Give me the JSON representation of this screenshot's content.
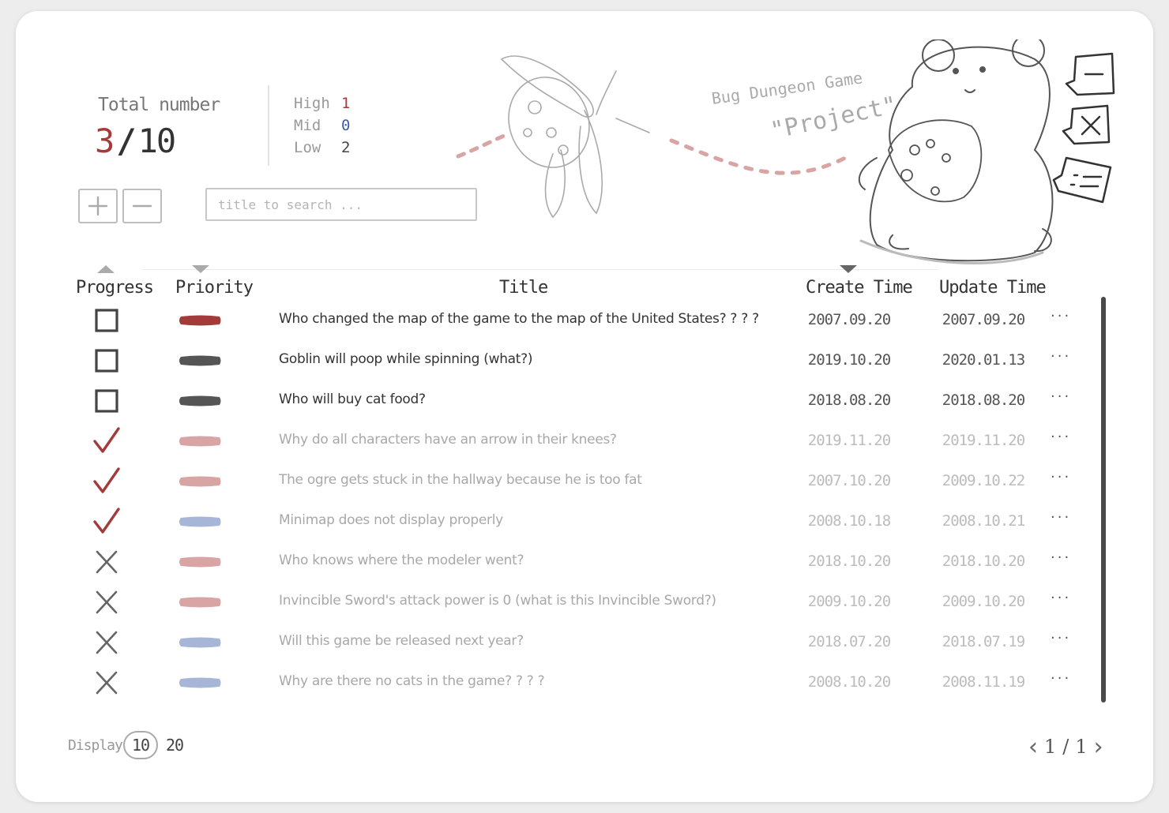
{
  "stats": {
    "total_label": "Total number",
    "done": "3",
    "separator": "/",
    "total": "10",
    "priorities": [
      {
        "label": "High",
        "value": "1",
        "level": "high"
      },
      {
        "label": "Mid",
        "value": "0",
        "level": "mid"
      },
      {
        "label": "Low",
        "value": "2",
        "level": "low"
      }
    ]
  },
  "toolbar": {
    "add_icon": "plus-icon",
    "remove_icon": "minus-icon",
    "search_placeholder": "title to search ..."
  },
  "illustration": {
    "project_line1": "Bug Dungeon Game",
    "project_line2": "\"Project\""
  },
  "table": {
    "columns": {
      "progress": "Progress",
      "priority": "Priority",
      "title": "Title",
      "create_time": "Create Time",
      "update_time": "Update Time"
    },
    "more_label": "···",
    "rows": [
      {
        "status": "open",
        "priority": "high",
        "title": "Who changed the map of the game to the map of the United States? ? ? ?",
        "create": "2007.09.20",
        "update": "2007.09.20"
      },
      {
        "status": "open",
        "priority": "low",
        "title": "Goblin will poop while spinning (what?)",
        "create": "2019.10.20",
        "update": "2020.01.13"
      },
      {
        "status": "open",
        "priority": "low",
        "title": "Who will buy cat food?",
        "create": "2018.08.20",
        "update": "2018.08.20"
      },
      {
        "status": "done",
        "priority": "high",
        "title": "Why do all characters have an arrow in their knees?",
        "create": "2019.11.20",
        "update": "2019.11.20"
      },
      {
        "status": "done",
        "priority": "high",
        "title": "The ogre gets stuck in the hallway because he is too fat",
        "create": "2007.10.20",
        "update": "2009.10.22"
      },
      {
        "status": "done",
        "priority": "mid",
        "title": "Minimap does not display properly",
        "create": "2008.10.18",
        "update": "2008.10.21"
      },
      {
        "status": "rejected",
        "priority": "high",
        "title": "Who knows where the modeler went?",
        "create": "2018.10.20",
        "update": "2018.10.20"
      },
      {
        "status": "rejected",
        "priority": "high",
        "title": "Invincible Sword's attack power is 0 (what is this Invincible Sword?)",
        "create": "2009.10.20",
        "update": "2009.10.20"
      },
      {
        "status": "rejected",
        "priority": "mid",
        "title": "Will this game be released next year?",
        "create": "2018.07.20",
        "update": "2018.07.19"
      },
      {
        "status": "rejected",
        "priority": "mid",
        "title": "Why are there no cats in the game? ? ? ?",
        "create": "2008.10.20",
        "update": "2008.11.19"
      }
    ]
  },
  "footer": {
    "display_label": "Display",
    "options": [
      "10",
      "20"
    ],
    "selected": "10",
    "page_current": "1",
    "page_sep": "/",
    "page_total": "1"
  },
  "colors": {
    "accent_red": "#a33b3b",
    "priority_high_open": "#a33b3b",
    "priority_low_open": "#555555",
    "priority_high_done": "#d8a4a4",
    "priority_mid_done": "#a7b6d6",
    "check": "#a33b3b",
    "cross": "#666666"
  }
}
